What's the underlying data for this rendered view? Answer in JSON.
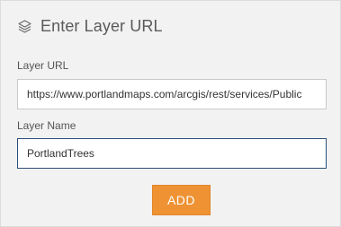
{
  "dialog": {
    "title": "Enter Layer URL",
    "icon": "layers-icon"
  },
  "layer_url": {
    "label": "Layer URL",
    "value": "https://www.portlandmaps.com/arcgis/rest/services/Public"
  },
  "layer_name": {
    "label": "Layer Name",
    "value": "PortlandTrees"
  },
  "add_button": {
    "label": "ADD",
    "color": "#ee9233"
  }
}
